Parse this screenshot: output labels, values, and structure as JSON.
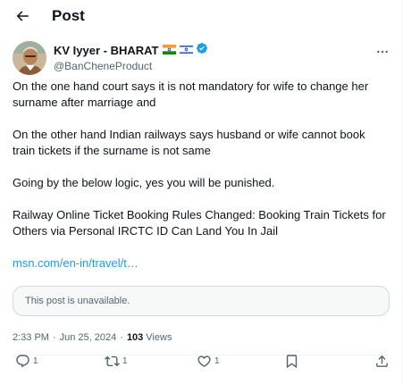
{
  "header": {
    "title": "Post"
  },
  "author": {
    "display_name": "KV Iyyer - BHARAT",
    "handle": "@BanCheneProduct"
  },
  "tweet": {
    "paragraphs": [
      "On the one hand court says it is not mandatory for wife to change her surname after marriage and",
      "On the other hand Indian railways says husband or wife cannot book train tickets if the surname is not same",
      "Going by the below logic, yes you will be punished.",
      "Railway Online Ticket Booking Rules Changed: Booking Train Tickets for Others via Personal IRCTC ID Can Land You In Jail"
    ],
    "link_text": "msn.com/en-in/travel/t…",
    "quoted_unavailable": "This post is unavailable."
  },
  "meta": {
    "time": "2:33 PM",
    "separator": "·",
    "date": "Jun 25, 2024",
    "separator2": "·",
    "views_count": "103",
    "views_label": "Views"
  },
  "actions": {
    "replies": "1",
    "reposts": "1",
    "likes": "1"
  },
  "icons": {
    "back": "arrow-left-icon",
    "more": "more-horizontal-icon",
    "verified": "verified-badge-icon",
    "reply": "reply-icon",
    "repost": "repost-icon",
    "like": "heart-icon",
    "bookmark": "bookmark-icon",
    "share": "share-icon"
  },
  "colors": {
    "accent": "#1d9bf0",
    "text_primary": "#0f1419",
    "text_secondary": "#536471",
    "border": "#cfd9de"
  }
}
